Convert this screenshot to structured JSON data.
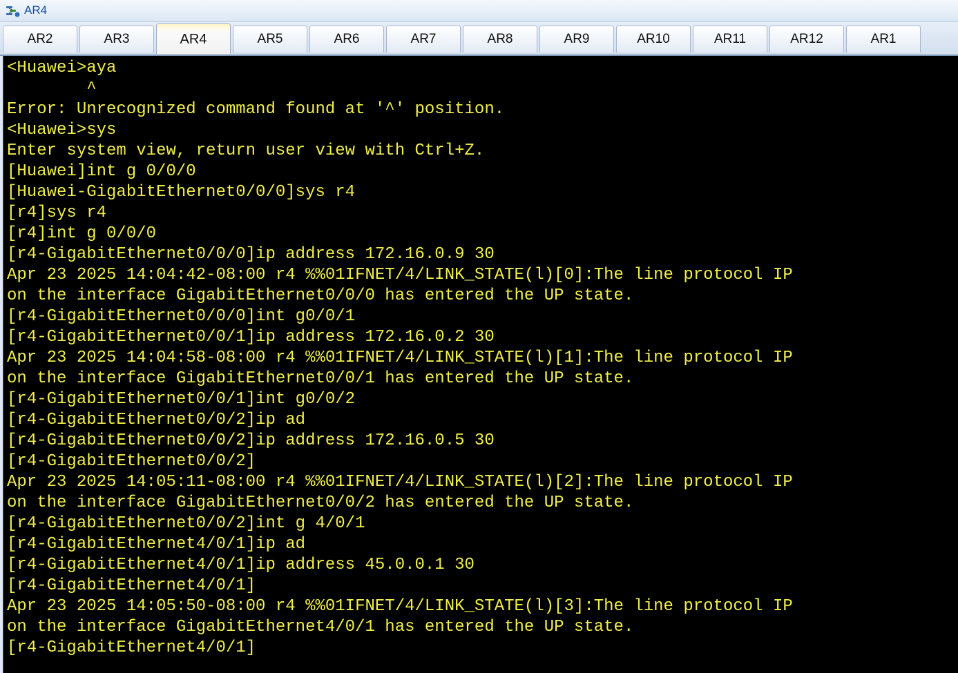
{
  "window": {
    "title": "AR4",
    "icon": "router-console-icon"
  },
  "tabs": [
    {
      "label": "AR2"
    },
    {
      "label": "AR3"
    },
    {
      "label": "AR4"
    },
    {
      "label": "AR5"
    },
    {
      "label": "AR6"
    },
    {
      "label": "AR7"
    },
    {
      "label": "AR8"
    },
    {
      "label": "AR9"
    },
    {
      "label": "AR10"
    },
    {
      "label": "AR11"
    },
    {
      "label": "AR12"
    },
    {
      "label": "AR1"
    }
  ],
  "active_tab": "AR4",
  "colors": {
    "terminal_bg": "#000000",
    "terminal_text": "#f0ee4a",
    "title_text": "#1c4f9c"
  },
  "terminal": {
    "lines": [
      "<Huawei>aya",
      "        ^",
      "Error: Unrecognized command found at '^' position.",
      "<Huawei>sys",
      "Enter system view, return user view with Ctrl+Z.",
      "[Huawei]int g 0/0/0",
      "[Huawei-GigabitEthernet0/0/0]sys r4",
      "[r4]sys r4",
      "[r4]int g 0/0/0",
      "[r4-GigabitEthernet0/0/0]ip address 172.16.0.9 30",
      "Apr 23 2025 14:04:42-08:00 r4 %%01IFNET/4/LINK_STATE(l)[0]:The line protocol IP",
      "on the interface GigabitEthernet0/0/0 has entered the UP state.",
      "[r4-GigabitEthernet0/0/0]int g0/0/1",
      "[r4-GigabitEthernet0/0/1]ip address 172.16.0.2 30",
      "Apr 23 2025 14:04:58-08:00 r4 %%01IFNET/4/LINK_STATE(l)[1]:The line protocol IP",
      "on the interface GigabitEthernet0/0/1 has entered the UP state.",
      "[r4-GigabitEthernet0/0/1]int g0/0/2",
      "[r4-GigabitEthernet0/0/2]ip ad",
      "[r4-GigabitEthernet0/0/2]ip address 172.16.0.5 30",
      "[r4-GigabitEthernet0/0/2]",
      "Apr 23 2025 14:05:11-08:00 r4 %%01IFNET/4/LINK_STATE(l)[2]:The line protocol IP",
      "on the interface GigabitEthernet0/0/2 has entered the UP state.",
      "[r4-GigabitEthernet0/0/2]int g 4/0/1",
      "[r4-GigabitEthernet4/0/1]ip ad",
      "[r4-GigabitEthernet4/0/1]ip address 45.0.0.1 30",
      "[r4-GigabitEthernet4/0/1]",
      "Apr 23 2025 14:05:50-08:00 r4 %%01IFNET/4/LINK_STATE(l)[3]:The line protocol IP",
      "on the interface GigabitEthernet4/0/1 has entered the UP state.",
      "[r4-GigabitEthernet4/0/1]"
    ]
  }
}
